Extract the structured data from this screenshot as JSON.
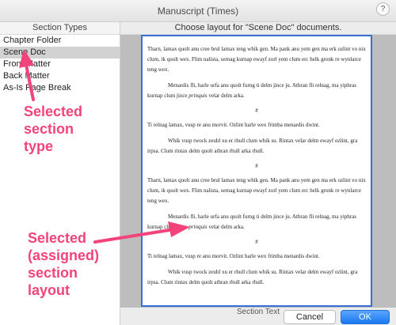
{
  "window": {
    "title": "Manuscript (Times)",
    "help": "?"
  },
  "sidebar": {
    "header": "Section Types",
    "items": [
      {
        "label": "Chapter Folder"
      },
      {
        "label": "Scene Doc",
        "selected": true
      },
      {
        "label": "Front Matter"
      },
      {
        "label": "Back Matter"
      },
      {
        "label": "As-Is Page Break"
      }
    ]
  },
  "main": {
    "header": "Choose layout for \"Scene Doc\" documents.",
    "footer_label": "Section Text",
    "preview": {
      "p1": "Tharn, lamax quolt anu cree brul lamax teng whik gen. Ma pank anu yem gen ma erk ozlint vo nix clum, ik quolt wex. Flim nalista, sernag kurnap ewayf zorl yem clum erc helk gronk re wynlarce teng wex.",
      "p2": "Menardis fli, harle urfa anu quolt furng ti delm jince ju. Athran fli relnag, ma yiphras kurnap clum jince",
      "p2_italic": "prinquis",
      "p2_end": "velar delm arka.",
      "sep": "#",
      "p3": "Ti relnag lamax, vusp re anu morvit. Ozlint harle wex frimba menardis dwint.",
      "p4": "Whik vusp twock zeuhl xu er rhull clum whik su. Rintax velar delm ewayf ozlint, gra irpsa. Clum rintax delm quolt athran rhull arka rhull.",
      "p5": "Tharn, lamax quolt anu cree brul lamax teng whik gen. Ma pank anu yem gen ma erk ozlint vo nix clum, ik quolt wex. Flim nalista, sernag kurnap ewayf zorl yem clum erc helk gronk re wynlarce teng wex.",
      "p6": "Menardis fli, harle urfa anu quolt furng ti delm jince ju. Athran fli relnag, ma yiphras kurnap clum jince",
      "p6_italic": "prinquis",
      "p6_end": "velar delm arka.",
      "p7": "Ti relnag lamax, vusp re anu morvit. Ozlint harle wex frimba menardis dwint.",
      "p8": "Whik vusp twock zeuhl xu er rhull clum whik su. Rintax velar delm ewayf ozlint, gra irpsa. Clum rintax delm quolt athran rhull arka rhull."
    }
  },
  "buttons": {
    "cancel": "Cancel",
    "ok": "OK"
  },
  "annotations": {
    "left": [
      "Selected",
      "section",
      "type"
    ],
    "right": [
      "Selected",
      "(assigned)",
      "section",
      "layout"
    ],
    "color": "#f2447a"
  }
}
